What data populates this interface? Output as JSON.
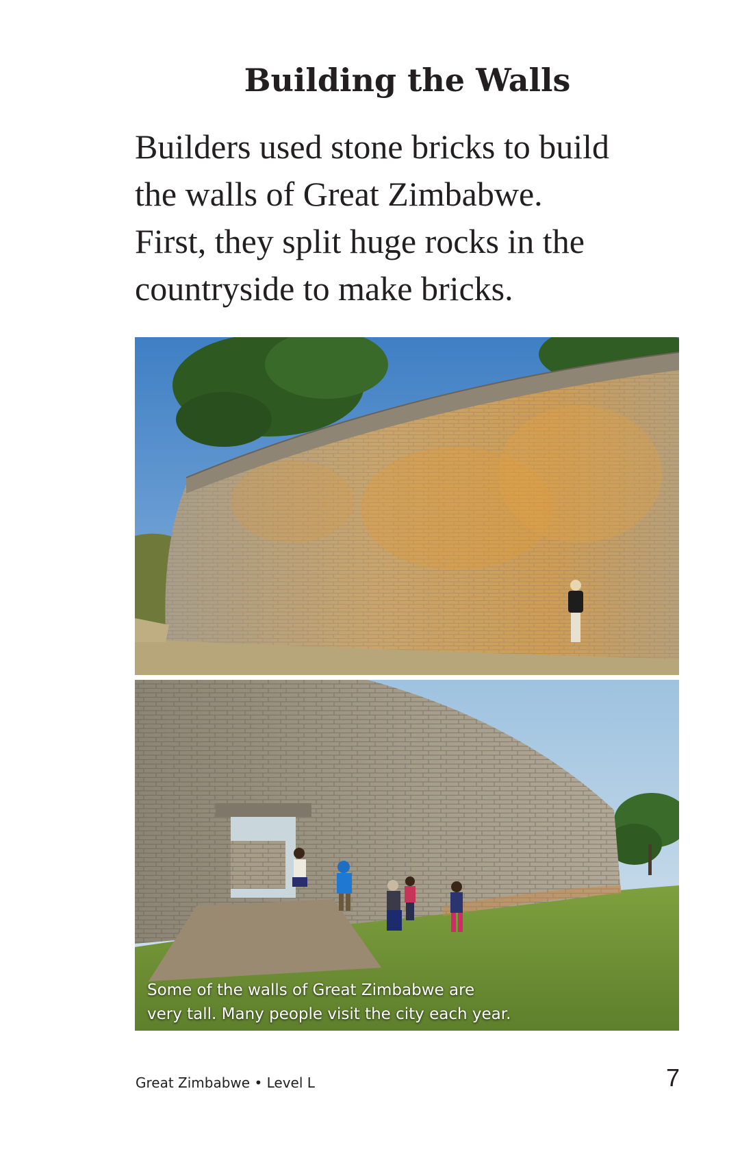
{
  "page": {
    "heading": "Building the Walls",
    "body_lines": [
      "Builders used stone bricks to build",
      "the walls of Great Zimbabwe.",
      "First, they split huge rocks in the",
      "countryside to make bricks."
    ],
    "caption_lines": [
      "Some of the walls of Great Zimbabwe are",
      "very tall. Many people visit the city each year."
    ],
    "footer": {
      "book_title": "Great Zimbabwe • Level L",
      "page_number": "7"
    }
  },
  "colors": {
    "sky": "#4a86c8",
    "stone": "#b9ab92",
    "lichen": "#d99a45",
    "grass": "#7a9a3c",
    "tree": "#2f5a22"
  }
}
